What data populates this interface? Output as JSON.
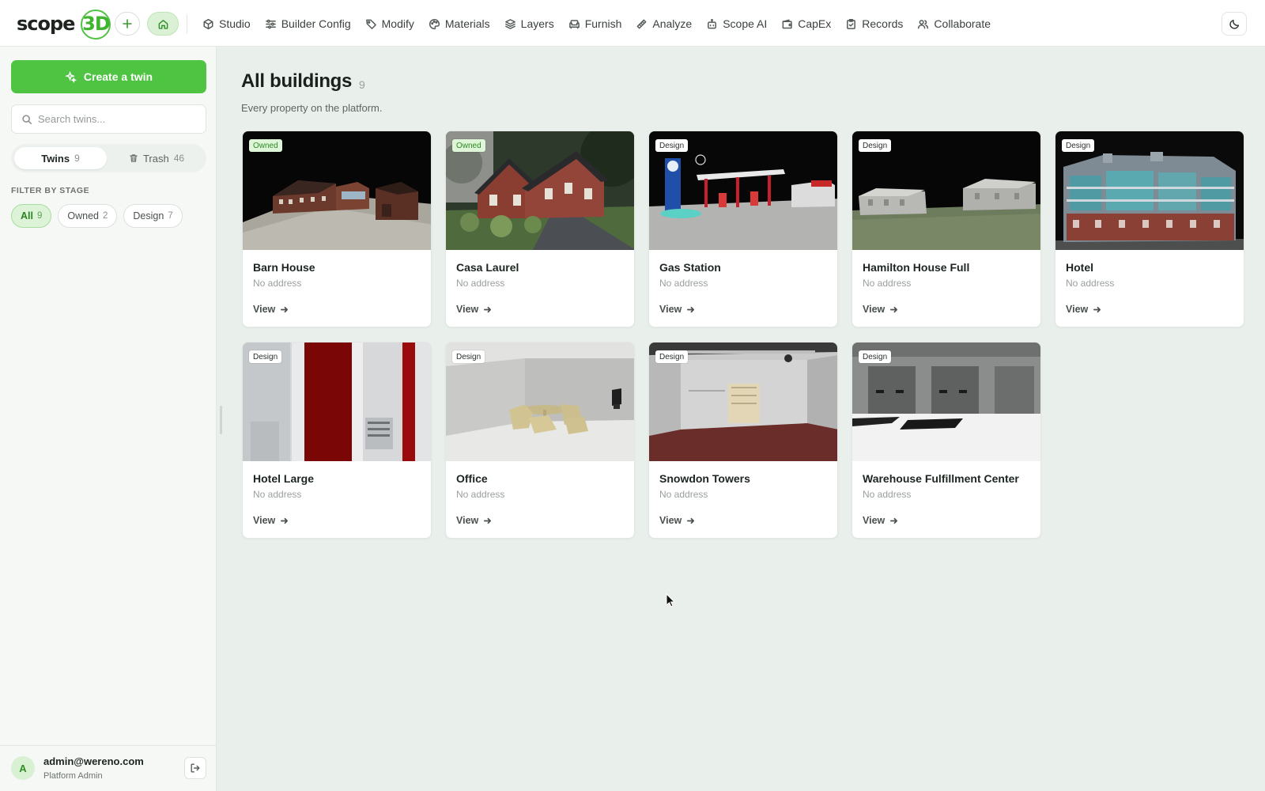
{
  "brand": {
    "name_part1": "scope",
    "name_part2": "3D"
  },
  "nav": [
    {
      "label": "Studio",
      "icon": "cube-icon"
    },
    {
      "label": "Builder Config",
      "icon": "sliders-icon"
    },
    {
      "label": "Modify",
      "icon": "tag-icon"
    },
    {
      "label": "Materials",
      "icon": "palette-icon"
    },
    {
      "label": "Layers",
      "icon": "layers-icon"
    },
    {
      "label": "Furnish",
      "icon": "sofa-icon"
    },
    {
      "label": "Analyze",
      "icon": "ruler-icon"
    },
    {
      "label": "Scope AI",
      "icon": "bot-icon"
    },
    {
      "label": "CapEx",
      "icon": "wallet-icon"
    },
    {
      "label": "Records",
      "icon": "clipboard-icon"
    },
    {
      "label": "Collaborate",
      "icon": "users-icon"
    }
  ],
  "sidebar": {
    "create_label": "Create a twin",
    "search_placeholder": "Search twins...",
    "tabs": {
      "twins": {
        "label": "Twins",
        "count": "9"
      },
      "trash": {
        "label": "Trash",
        "count": "46"
      }
    },
    "filter_label": "FILTER BY STAGE",
    "filters": [
      {
        "label": "All",
        "count": "9",
        "active": true
      },
      {
        "label": "Owned",
        "count": "2",
        "active": false
      },
      {
        "label": "Design",
        "count": "7",
        "active": false
      }
    ],
    "user": {
      "initial": "A",
      "email": "admin@wereno.com",
      "role": "Platform Admin"
    }
  },
  "main": {
    "title": "All buildings",
    "count": "9",
    "subtitle": "Every property on the platform.",
    "view_label": "View",
    "cards": [
      {
        "name": "Barn House",
        "address": "No address",
        "stage": "Owned"
      },
      {
        "name": "Casa Laurel",
        "address": "No address",
        "stage": "Owned"
      },
      {
        "name": "Gas Station",
        "address": "No address",
        "stage": "Design"
      },
      {
        "name": "Hamilton House Full",
        "address": "No address",
        "stage": "Design"
      },
      {
        "name": "Hotel",
        "address": "No address",
        "stage": "Design"
      },
      {
        "name": "Hotel Large",
        "address": "No address",
        "stage": "Design"
      },
      {
        "name": "Office",
        "address": "No address",
        "stage": "Design"
      },
      {
        "name": "Snowdon Towers",
        "address": "No address",
        "stage": "Design"
      },
      {
        "name": "Warehouse Fulfillment Center",
        "address": "No address",
        "stage": "Design"
      }
    ]
  },
  "colors": {
    "accent": "#4fc443",
    "accent_dark": "#2f8a25",
    "background": "#e9efea"
  }
}
